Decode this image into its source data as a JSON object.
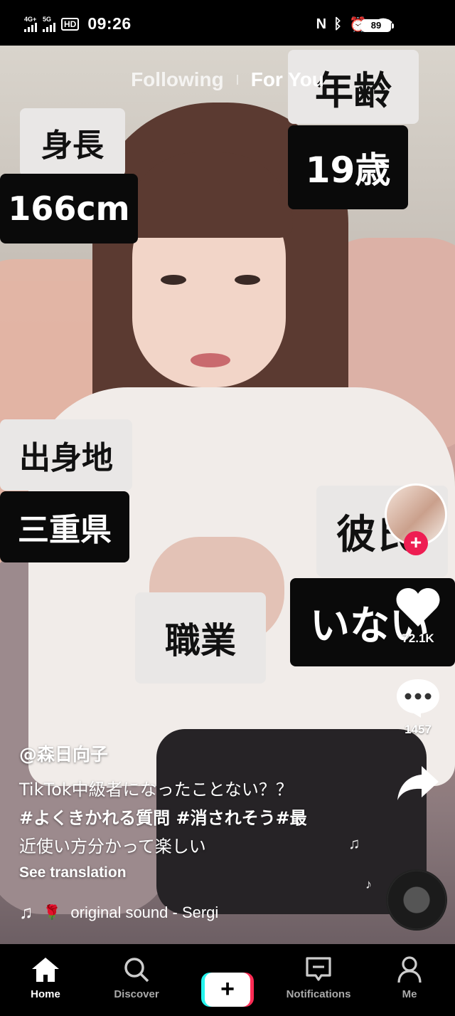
{
  "status_bar": {
    "net1": "4G+",
    "net2": "5G",
    "hd": "HD",
    "time": "09:26",
    "battery": "89",
    "icons": [
      "nfc-icon",
      "bluetooth-icon",
      "alarm-icon",
      "wifi-icon"
    ]
  },
  "tabs": {
    "following": "Following",
    "for_you": "For You"
  },
  "overlay": {
    "height_label": "身長",
    "height_value": "166cm",
    "age_label": "年齢",
    "age_value": "19歳",
    "hometown_label": "出身地",
    "hometown_value": "三重県",
    "partner_label": "彼氏",
    "partner_value": "いない",
    "job_label": "職業"
  },
  "rail": {
    "likes": "72.1K",
    "comments": "1457",
    "colors": {
      "follow": "#ee1d52"
    }
  },
  "caption": {
    "username": "@森日向子",
    "text": "TikTok中級者になったことない？？",
    "hashtags": "#よくきかれる質問 #消されそう#最",
    "text2": "近使い方分かって楽しい",
    "see_translation": "See translation"
  },
  "sound": {
    "title": "original sound - Sergi"
  },
  "nav": {
    "home": "Home",
    "discover": "Discover",
    "create": "+",
    "notifications": "Notifications",
    "me": "Me"
  }
}
